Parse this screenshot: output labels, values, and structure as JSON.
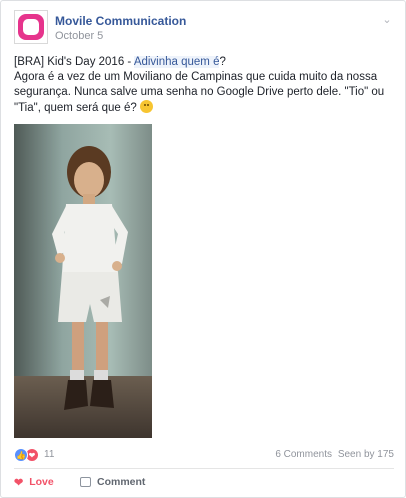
{
  "post": {
    "page_name": "Movile Communication",
    "date": "October 5",
    "text_line1_prefix": "[BRA] Kid's Day 2016 - ",
    "text_line1_highlight": "Adivinha quem é",
    "text_line1_suffix": "?",
    "text_body": "Agora é a vez de um Moviliano de Campinas que cuida muito da nossa segurança. Nunca salve uma senha no Google Drive perto dele. \"Tio\" ou \"Tia\", quem será que é?",
    "emoji": "smile-emoji"
  },
  "colors": {
    "brand": "#e6348c",
    "link": "#365899",
    "love": "#f25268",
    "like": "#5890ff"
  },
  "stats": {
    "reactions_count": "11",
    "comments": "6 Comments",
    "seen": "Seen by 175"
  },
  "actions": {
    "love_label": "Love",
    "comment_label": "Comment"
  },
  "icons": {
    "menu": "chevron-down-icon",
    "like": "like-icon",
    "love": "heart-icon",
    "comment": "comment-icon"
  }
}
